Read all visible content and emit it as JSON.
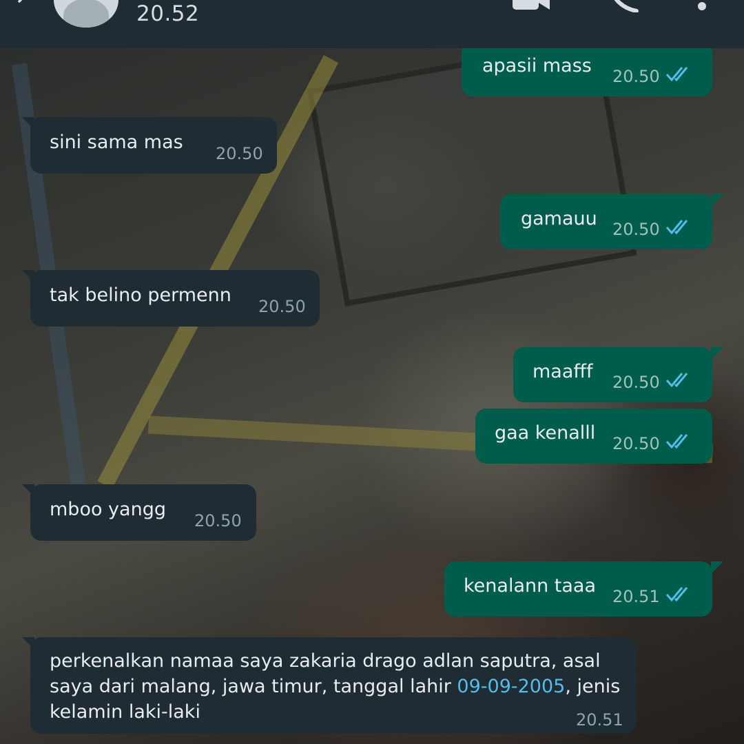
{
  "header": {
    "last_seen": "20.52"
  },
  "messages": [
    {
      "direction": "out",
      "text": "apasii mass",
      "time": "20.50",
      "status": "read"
    },
    {
      "direction": "in",
      "text": "sini sama mas",
      "time": "20.50"
    },
    {
      "direction": "out",
      "text": "gamauu",
      "time": "20.50",
      "status": "read"
    },
    {
      "direction": "in",
      "text": "tak belino permenn",
      "time": "20.50"
    },
    {
      "direction": "out",
      "text": "maafff",
      "time": "20.50",
      "status": "read"
    },
    {
      "direction": "out",
      "text": "gaa kenalll",
      "time": "20.50",
      "status": "read"
    },
    {
      "direction": "in",
      "text": "mboo yangg",
      "time": "20.50"
    },
    {
      "direction": "out",
      "text": "kenalann taaa",
      "time": "20.51",
      "status": "read"
    },
    {
      "direction": "in",
      "text_before": "perkenalkan namaa saya zakaria drago adlan saputra, asal saya dari malang, jawa timur, tanggal lahir ",
      "link": "09-09-2005",
      "text_after": ", jenis kelamin laki-laki",
      "time": "20.51"
    }
  ],
  "colors": {
    "header_bg": "#1f2c34",
    "incoming_bubble": "#1f2c34",
    "outgoing_bubble": "#005c4b",
    "read_tick": "#53bdeb",
    "link": "#53bdeb"
  },
  "icons": {
    "back": "arrow-back-icon",
    "avatar": "default-avatar-icon",
    "video_call": "video-camera-icon",
    "voice_call": "phone-icon",
    "menu": "more-vertical-icon",
    "read_receipt": "double-check-icon"
  }
}
